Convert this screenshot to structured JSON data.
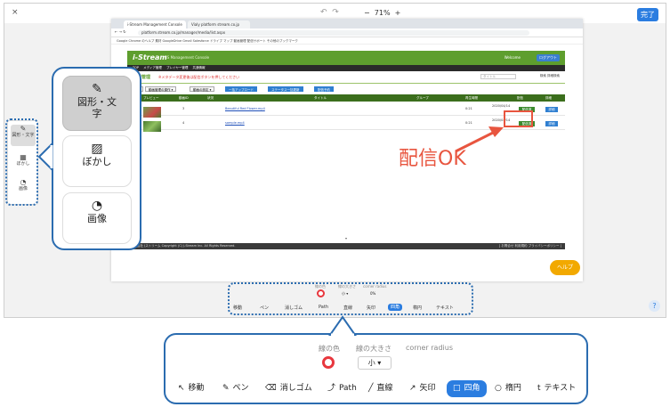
{
  "editor": {
    "close": "×",
    "undo": "↶",
    "redo": "↷",
    "zoom_out": "−",
    "zoom_in": "+",
    "zoom": "71%",
    "done": "完了",
    "help": "?"
  },
  "mini_toolbar": [
    {
      "icon": "✎",
      "label": "図形・文字"
    },
    {
      "icon": "▦",
      "label": "ぼかし"
    },
    {
      "icon": "◔",
      "label": "画像"
    }
  ],
  "callout_tools": [
    {
      "icon": "pen-icon",
      "glyph": "✎",
      "label": "図形・文\n字"
    },
    {
      "icon": "blur-icon",
      "glyph": "▨",
      "label": "ぼかし"
    },
    {
      "icon": "image-icon",
      "glyph": "◔",
      "label": "画像"
    }
  ],
  "browser": {
    "tabs": [
      "i-Stream Management Console",
      "Vialy platform stream.co.jp"
    ],
    "url": "platform.stream.co.jp/manager/media/list.aspx",
    "bookmarks": "Google Chrome のヘルプ   素材   GoogleDrive   Gmail   Salesforce   ドライブ   マップ   動画管理   配信サポート   その他のブックマーク"
  },
  "app": {
    "logo": "i-Stream",
    "subtitle": "CS Management Console",
    "welcome": "Welcome",
    "logout": "ログアウト",
    "nav": "TOP  メディア管理  プレイヤー管理  共通情報",
    "section_title": "動画管理",
    "section_sub": "※メタデータ変更後は配信ボタンを押してください",
    "search_placeholder": "タイトル",
    "search_btn": "検索   詳細検索",
    "actions": [
      "＋",
      "動画管理の操作 ▾",
      "動画の設定 ▾",
      "一括アップロード",
      "ステータス一括更新",
      "配信予約"
    ],
    "columns": [
      "プレビュー",
      "動画ID",
      "状況",
      "タイトル",
      "グループ",
      "再生時間",
      "配信",
      "詳細"
    ],
    "rows": [
      {
        "id": "3",
        "title": "Beautiful Red Flower.mp4",
        "time": "0:21",
        "date": "2020/04/14",
        "deliver": "配信済",
        "detail": "詳細"
      },
      {
        "id": "4",
        "title": "sample.mp4",
        "time": "0:21",
        "date": "2020/04/14",
        "deliver": "配信済",
        "detail": "詳細"
      }
    ],
    "footer_left": "株式会社 Jストリーム  Copyright (C) J-Stream Inc. All Rights Reserved.",
    "footer_right": "[ お問合せ 利用規約 プライバシーポリシー ]"
  },
  "annotation": {
    "text": "配信OK",
    "color": "#e8553f"
  },
  "help_chip": "ヘルプ",
  "panel": {
    "line_color_label": "線の色",
    "line_size_label": "線の大きさ",
    "corner_radius_label": "corner radius",
    "line_size_value": "小 ▾",
    "corner_radius_value": "0%",
    "line_color": "#e8373e",
    "tools": [
      {
        "icon": "cursor-icon",
        "glyph": "↖",
        "label": "移動"
      },
      {
        "icon": "pen-icon",
        "glyph": "✎",
        "label": "ペン"
      },
      {
        "icon": "eraser-icon",
        "glyph": "⌫",
        "label": "消しゴム"
      },
      {
        "icon": "path-icon",
        "glyph": "⤴",
        "label": "Path"
      },
      {
        "icon": "line-icon",
        "glyph": "╱",
        "label": "直線"
      },
      {
        "icon": "arrow-icon",
        "glyph": "↗",
        "label": "矢印"
      },
      {
        "icon": "square-icon",
        "glyph": "□",
        "label": "四角"
      },
      {
        "icon": "circle-icon",
        "glyph": "○",
        "label": "楕円"
      },
      {
        "icon": "text-icon",
        "glyph": "t",
        "label": "テキスト"
      }
    ],
    "active_tool": "四角"
  },
  "colors": {
    "accent": "#2b7de0",
    "annotation": "#e8553f",
    "frame": "#2b6cb0",
    "app_green": "#5e9e2e"
  }
}
